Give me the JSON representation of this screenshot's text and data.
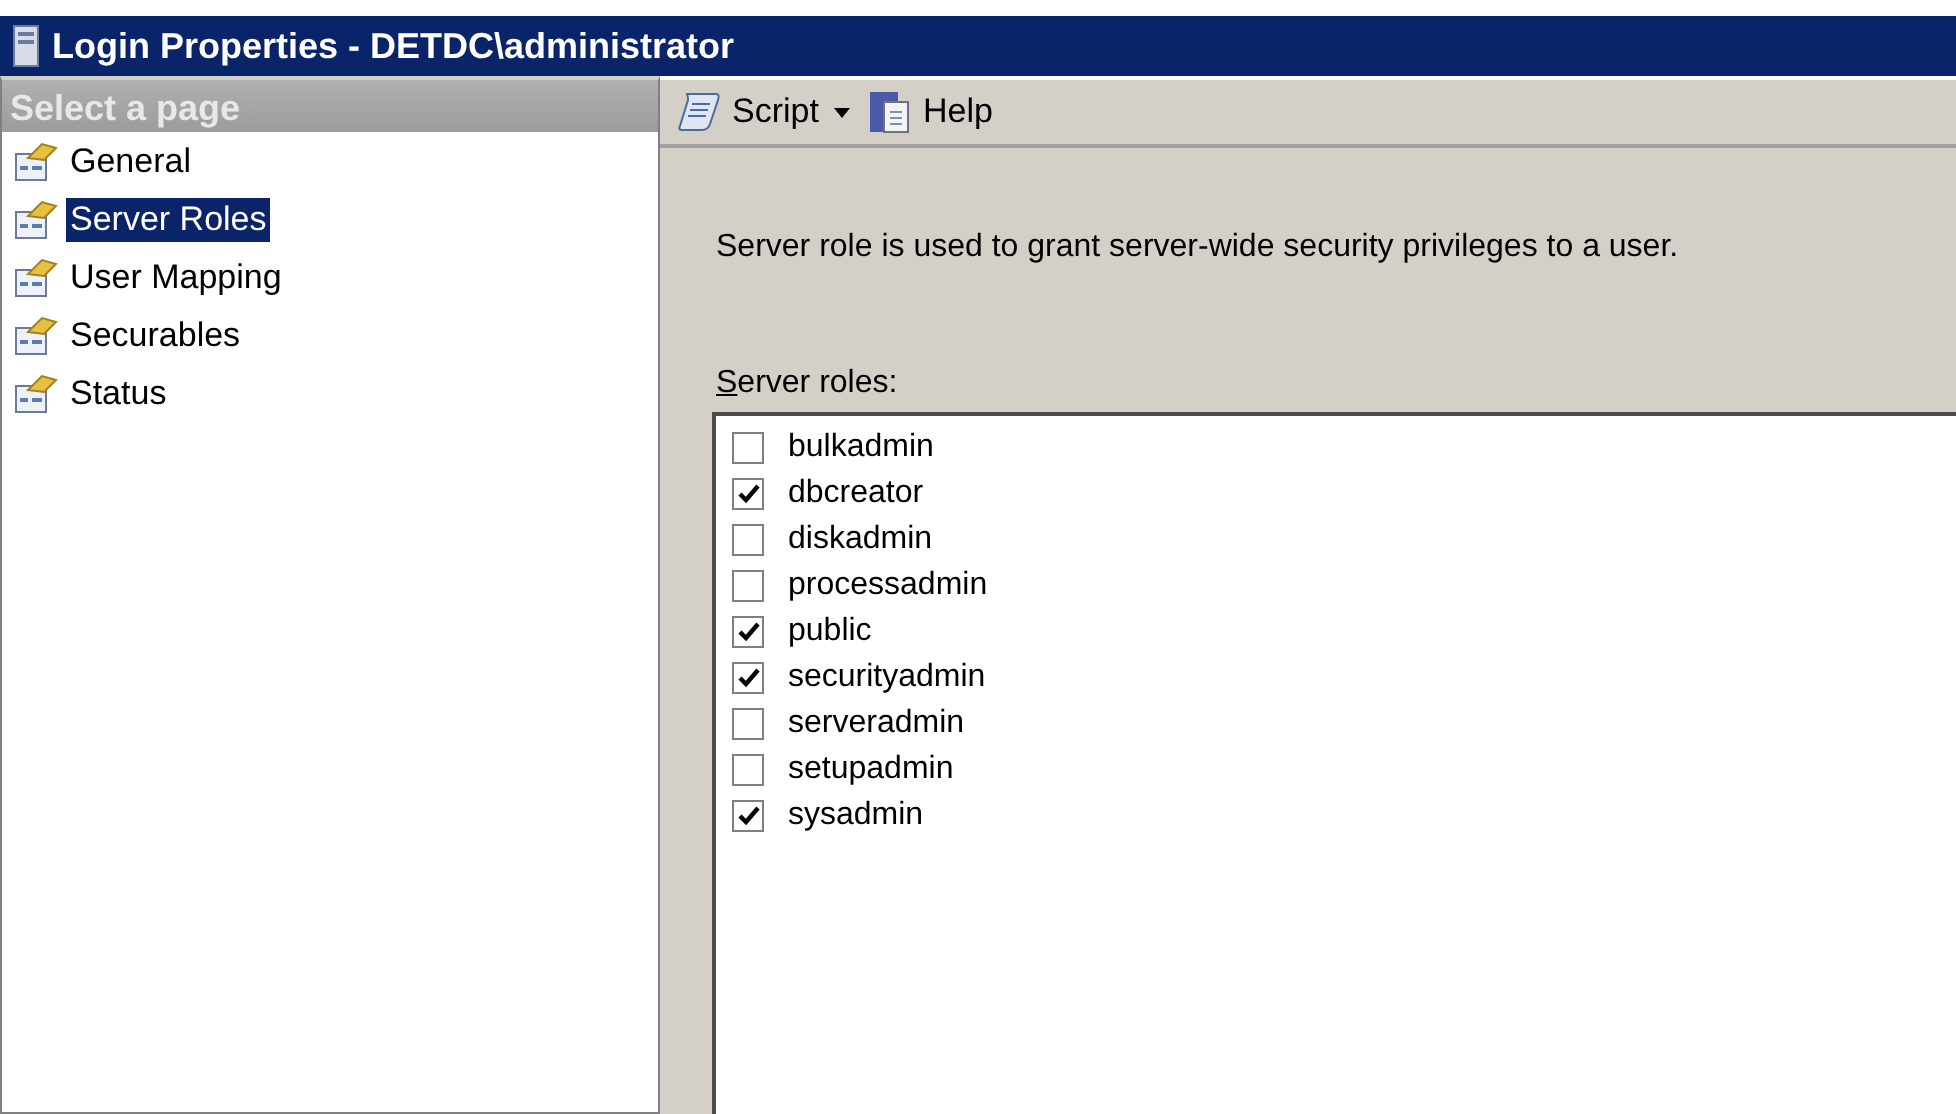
{
  "window": {
    "title": "Login Properties - DETDC\\administrator"
  },
  "sidebar": {
    "header": "Select a page",
    "items": [
      {
        "label": "General",
        "selected": false
      },
      {
        "label": "Server Roles",
        "selected": true
      },
      {
        "label": "User Mapping",
        "selected": false
      },
      {
        "label": "Securables",
        "selected": false
      },
      {
        "label": "Status",
        "selected": false
      }
    ]
  },
  "toolbar": {
    "buttons": [
      {
        "kind": "script",
        "label": "Script"
      },
      {
        "kind": "help",
        "label": "Help"
      }
    ]
  },
  "description": "Server role is used to grant server-wide security privileges to a user.",
  "roles_label": {
    "text": "Server roles:",
    "first_letter_underlined": true
  },
  "roles": [
    {
      "name": "bulkadmin",
      "checked": false
    },
    {
      "name": "dbcreator",
      "checked": true
    },
    {
      "name": "diskadmin",
      "checked": false
    },
    {
      "name": "processadmin",
      "checked": false
    },
    {
      "name": "public",
      "checked": true
    },
    {
      "name": "securityadmin",
      "checked": true
    },
    {
      "name": "serveradmin",
      "checked": false
    },
    {
      "name": "setupadmin",
      "checked": false
    },
    {
      "name": "sysadmin",
      "checked": true
    }
  ]
}
